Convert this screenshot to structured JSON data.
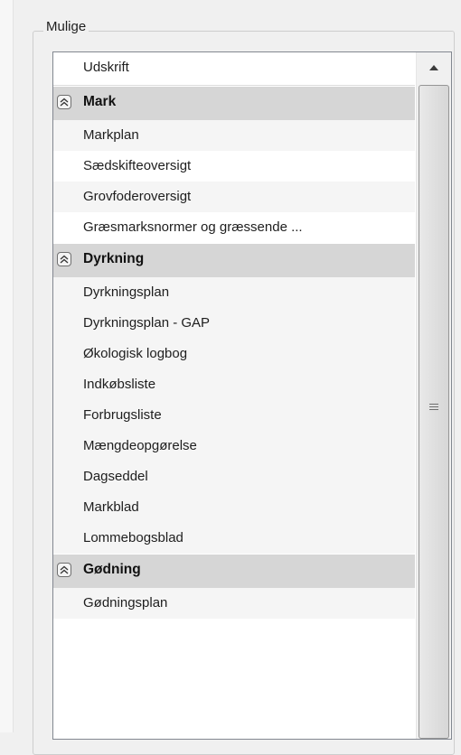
{
  "groupbox": {
    "title": "Mulige"
  },
  "list": {
    "header": "Udskrift",
    "groups": [
      {
        "name": "Mark",
        "items": [
          "Markplan",
          "Sædskifteoversigt",
          "Grovfoderoversigt",
          "Græsmarksnormer og græssende ..."
        ]
      },
      {
        "name": "Dyrkning",
        "items": [
          "Dyrkningsplan",
          "Dyrkningsplan - GAP",
          "Økologisk logbog",
          "Indkøbsliste",
          "Forbrugsliste",
          "Mængdeopgørelse",
          "Dagseddel",
          "Markblad",
          "Lommebogsblad"
        ]
      },
      {
        "name": "Gødning",
        "items": [
          "Gødningsplan"
        ]
      }
    ]
  },
  "icons": {
    "group_toggle": "collapse-chevron-icon",
    "scroll_up": "scroll-up-arrow-icon",
    "scroll_grip": "scroll-grip-icon"
  }
}
